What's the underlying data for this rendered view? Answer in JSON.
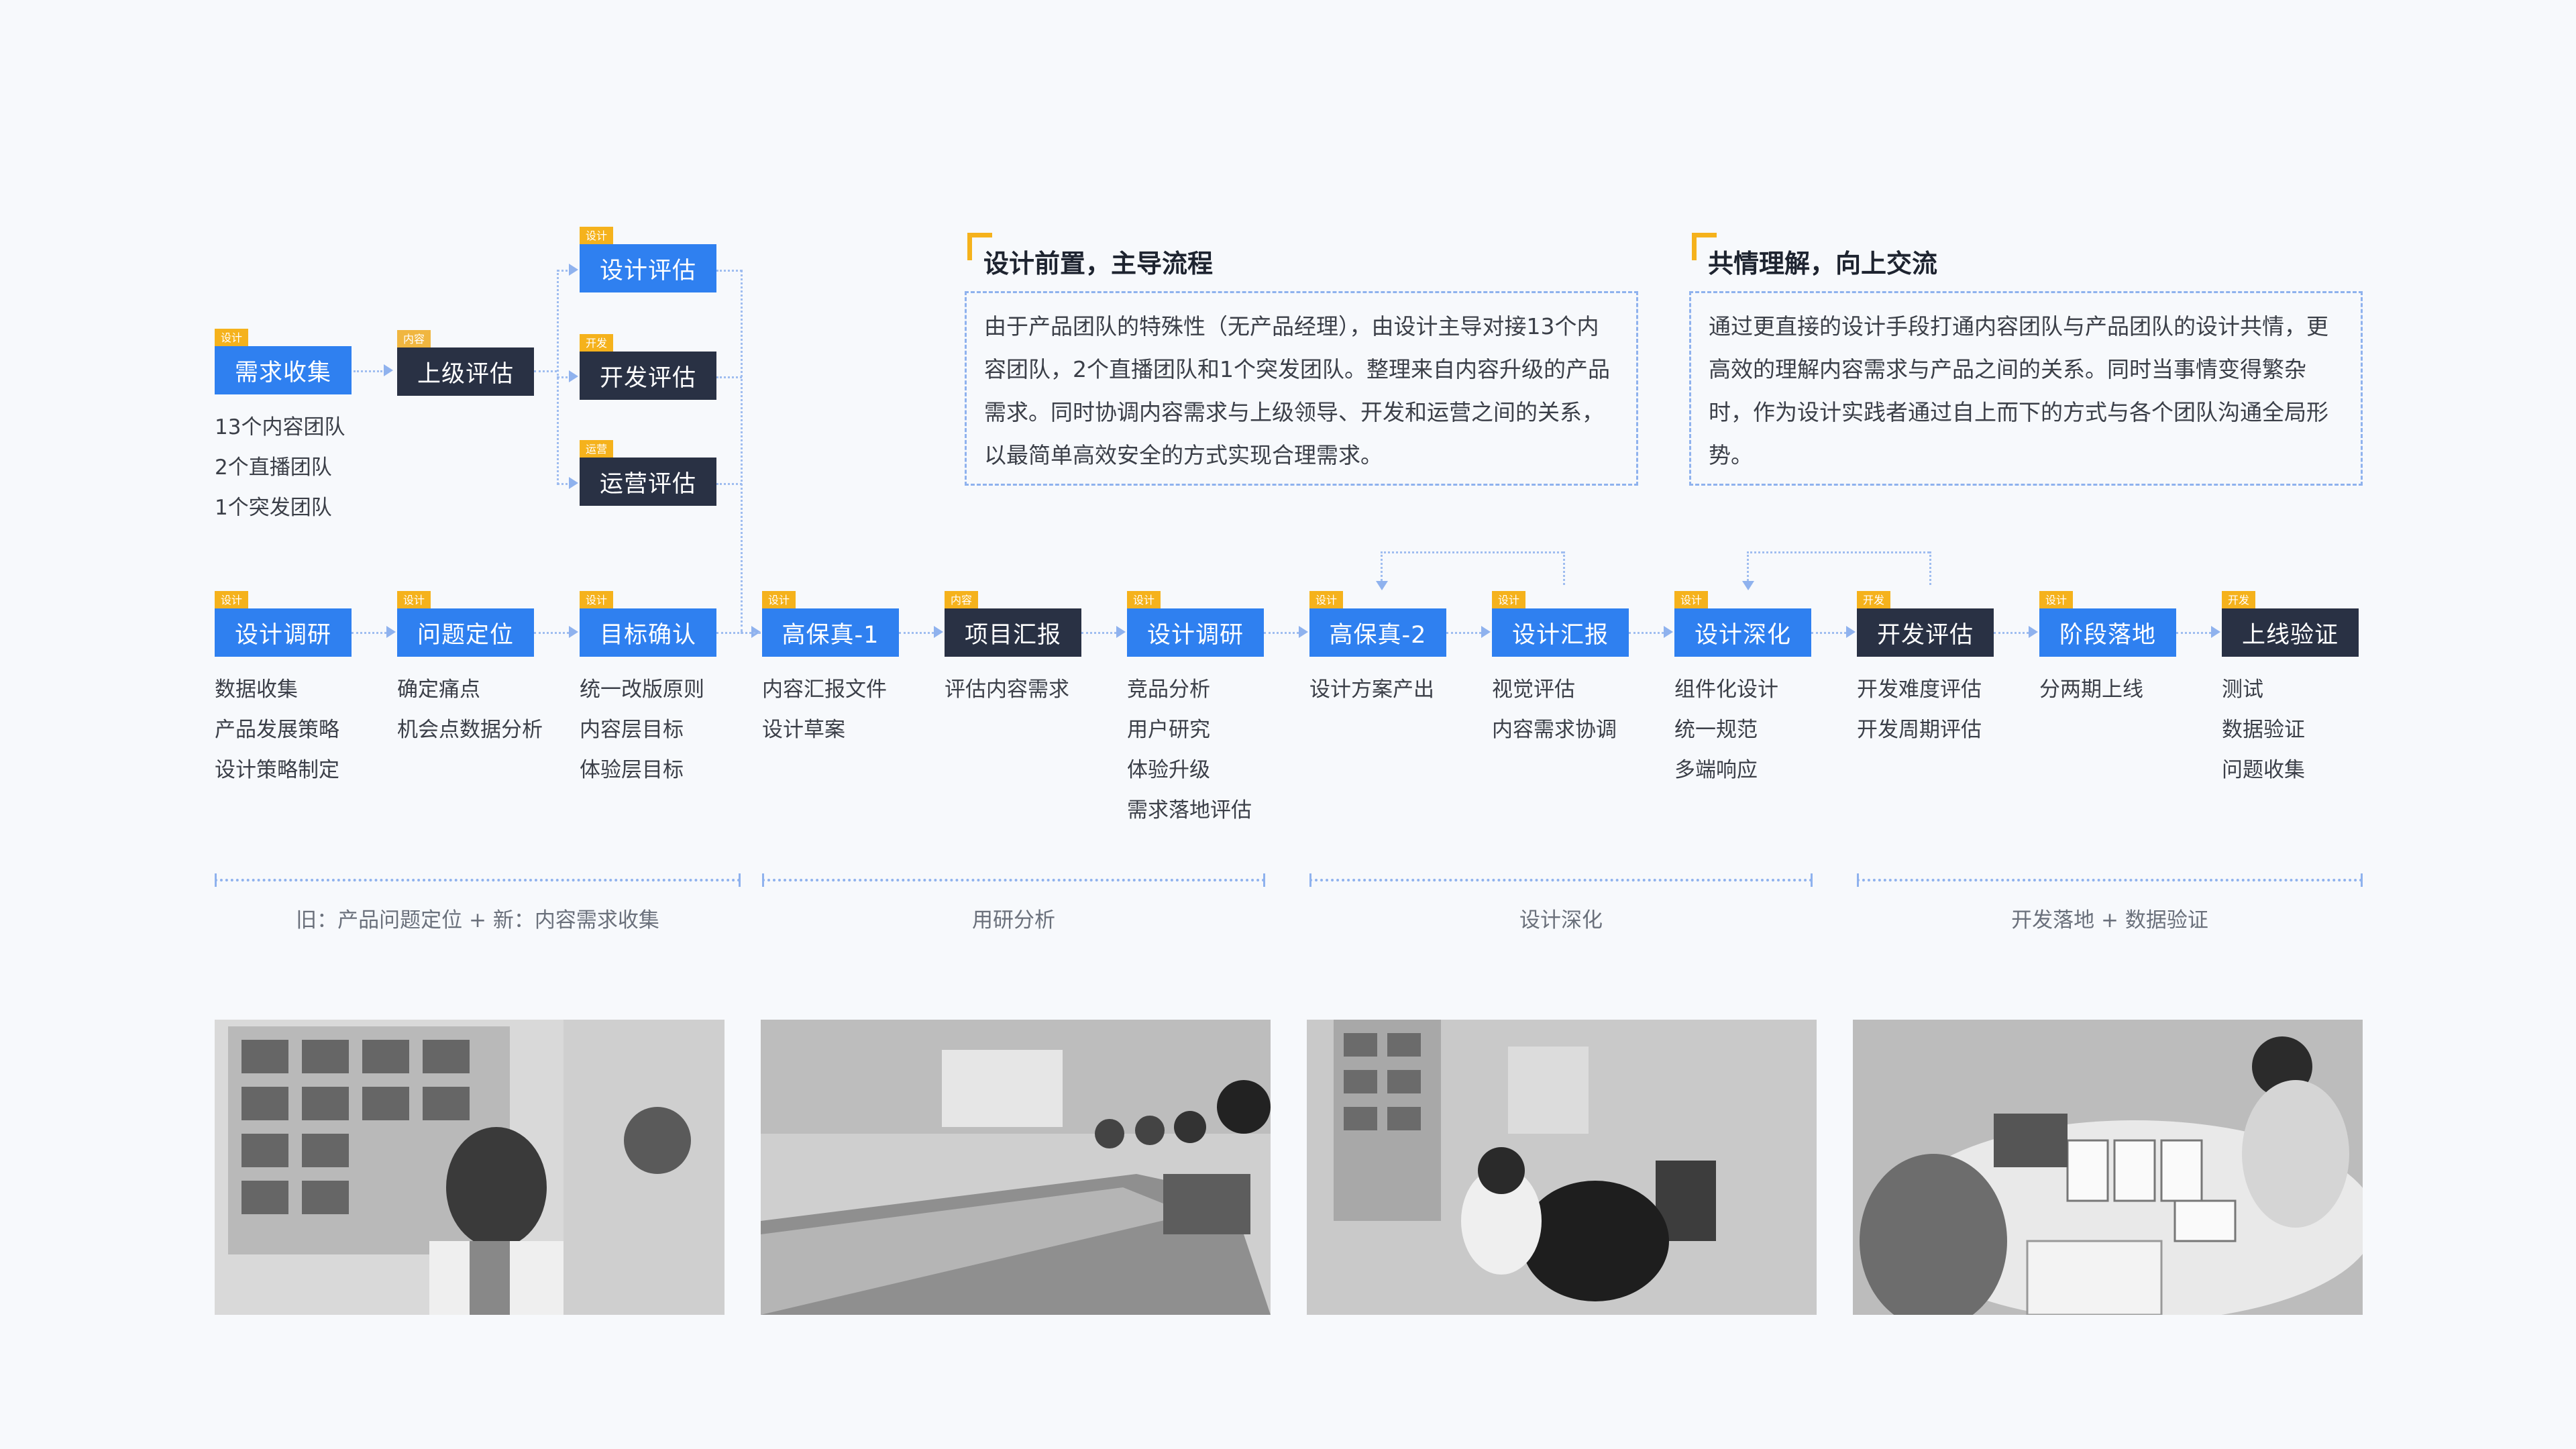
{
  "top_nodes": {
    "demand": {
      "tag": "设计",
      "label": "需求收集",
      "items": [
        "13个内容团队",
        "2个直播团队",
        "1个突发团队"
      ]
    },
    "superior": {
      "tag": "内容",
      "label": "上级评估"
    },
    "design_eval": {
      "tag": "设计",
      "label": "设计评估"
    },
    "dev_eval": {
      "tag": "开发",
      "label": "开发评估"
    },
    "ops_eval": {
      "tag": "运营",
      "label": "运营评估"
    }
  },
  "callouts": [
    {
      "title": "设计前置，主导流程",
      "text": "由于产品团队的特殊性（无产品经理），由设计主导对接13个内容团队，2个直播团队和1个突发团队。整理来自内容升级的产品需求。同时协调内容需求与上级领导、开发和运营之间的关系，以最简单高效安全的方式实现合理需求。"
    },
    {
      "title": "共情理解，向上交流",
      "text": "通过更直接的设计手段打通内容团队与产品团队的设计共情，更高效的理解内容需求与产品之间的关系。同时当事情变得繁杂时，作为设计实践者通过自上而下的方式与各个团队沟通全局形势。"
    }
  ],
  "flow": [
    {
      "tag": "设计",
      "label": "设计调研",
      "style": "blue",
      "items": [
        "数据收集",
        "产品发展策略",
        "设计策略制定"
      ]
    },
    {
      "tag": "设计",
      "label": "问题定位",
      "style": "blue",
      "items": [
        "确定痛点",
        "机会点数据分析"
      ]
    },
    {
      "tag": "设计",
      "label": "目标确认",
      "style": "blue",
      "items": [
        "统一改版原则",
        "内容层目标",
        "体验层目标"
      ]
    },
    {
      "tag": "设计",
      "label": "高保真-1",
      "style": "blue",
      "items": [
        "内容汇报文件",
        "设计草案"
      ]
    },
    {
      "tag": "内容",
      "label": "项目汇报",
      "style": "dark",
      "items": [
        "评估内容需求"
      ]
    },
    {
      "tag": "设计",
      "label": "设计调研",
      "style": "blue",
      "items": [
        "竞品分析",
        "用户研究",
        "体验升级",
        "需求落地评估"
      ]
    },
    {
      "tag": "设计",
      "label": "高保真-2",
      "style": "blue",
      "items": [
        "设计方案产出"
      ]
    },
    {
      "tag": "设计",
      "label": "设计汇报",
      "style": "blue",
      "items": [
        "视觉评估",
        "内容需求协调"
      ]
    },
    {
      "tag": "设计",
      "label": "设计深化",
      "style": "blue",
      "items": [
        "组件化设计",
        "统一规范",
        "多端响应"
      ]
    },
    {
      "tag": "开发",
      "label": "开发评估",
      "style": "dark",
      "items": [
        "开发难度评估",
        "开发周期评估"
      ]
    },
    {
      "tag": "设计",
      "label": "阶段落地",
      "style": "blue",
      "items": [
        "分两期上线"
      ]
    },
    {
      "tag": "开发",
      "label": "上线验证",
      "style": "dark",
      "items": [
        "测试",
        "数据验证",
        "问题收集"
      ]
    }
  ],
  "phases": [
    {
      "label": "旧：产品问题定位 + 新：内容需求收集"
    },
    {
      "label": "用研分析"
    },
    {
      "label": "设计深化"
    },
    {
      "label": "开发落地 + 数据验证"
    }
  ],
  "photos": [
    {
      "icon": "team-member-photo"
    },
    {
      "icon": "meeting-room-photo"
    },
    {
      "icon": "design-review-photo"
    },
    {
      "icon": "workshop-photo"
    }
  ]
}
